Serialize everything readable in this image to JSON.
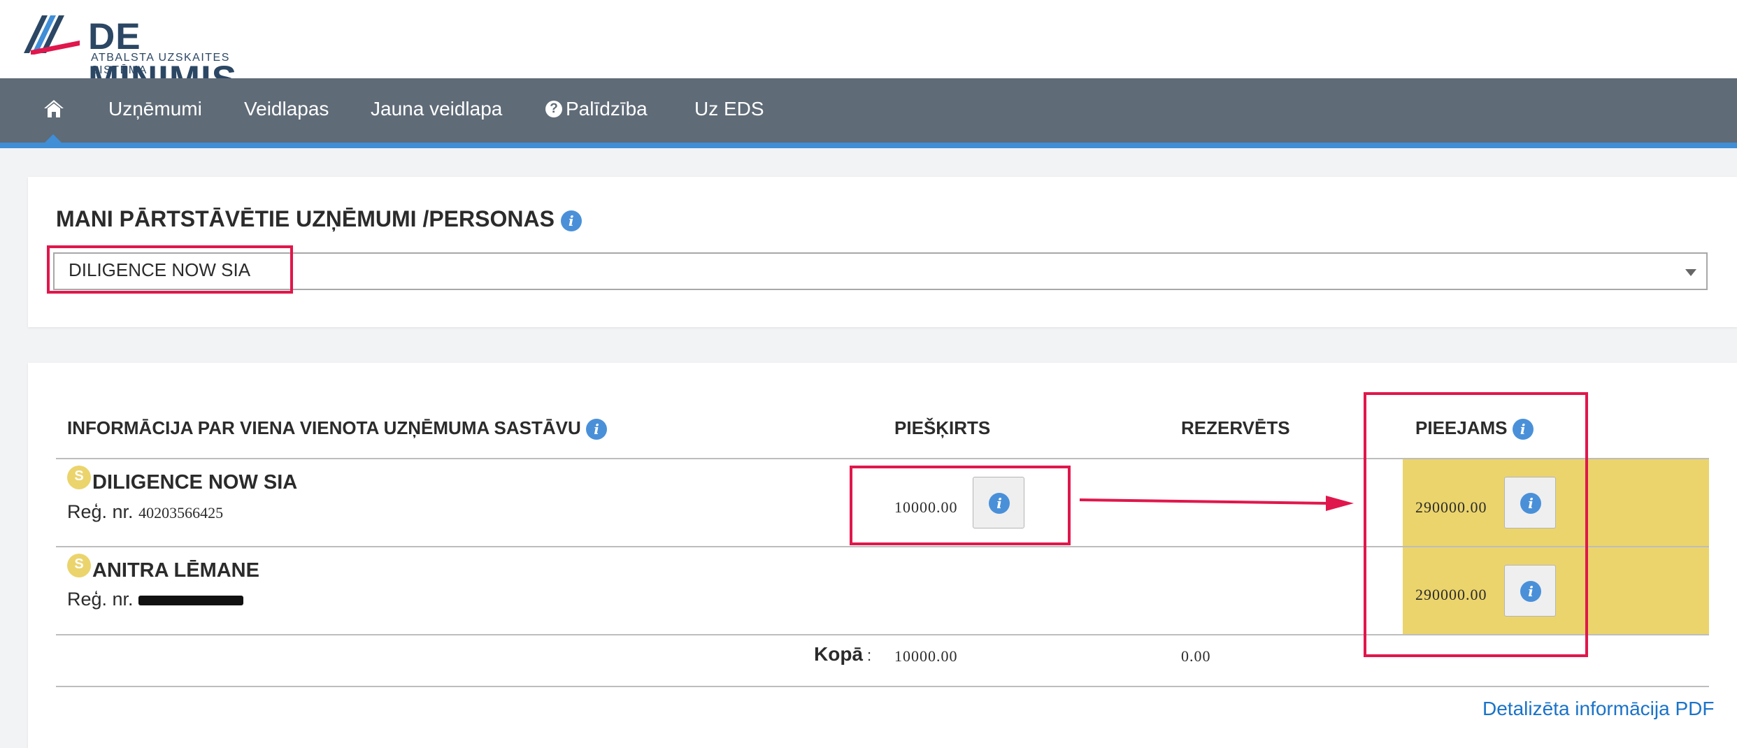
{
  "logo": {
    "name": "DE MINIMIS",
    "tagline": "ATBALSTA UZSKAITES SISTĒMA"
  },
  "nav": {
    "home_icon": "home-icon",
    "items": [
      {
        "label": "Uzņēmumi"
      },
      {
        "label": "Veidlapas"
      },
      {
        "label": "Jauna veidlapa"
      },
      {
        "label": "Palīdzība",
        "icon": "question-circle-icon"
      },
      {
        "label": "Uz EDS"
      }
    ]
  },
  "represented": {
    "title": "MANI PĀRTSTĀVĒTIE UZŅĒMUMI /PERSONAS",
    "selected": "DILIGENCE NOW SIA"
  },
  "table": {
    "headers": {
      "composition": "INFORMĀCIJA PAR VIENA VIENOTA UZŅĒMUMA SASTĀVU",
      "granted": "PIEŠĶIRTS",
      "reserved": "REZERVĒTS",
      "available": "PIEEJAMS"
    },
    "rows": [
      {
        "badge": "S",
        "name": "DILIGENCE NOW SIA",
        "reg_label": "Reģ. nr.",
        "reg_no": "40203566425",
        "granted": "10000.00",
        "available": "290000.00"
      },
      {
        "badge": "S",
        "name": "ANITRA LĒMANE",
        "reg_label": "Reģ. nr.",
        "reg_no": "",
        "granted": "",
        "available": "290000.00"
      }
    ],
    "total": {
      "label": "Kopā",
      "colon": ":",
      "granted": "10000.00",
      "reserved": "0.00"
    },
    "pdf_link": "Detalizēta informācija PDF"
  },
  "colors": {
    "nav_bg": "#5f6b77",
    "accent_blue": "#3f8ed6",
    "highlight_yellow": "#ebd46c",
    "annotation_red": "#e0174c",
    "link_blue": "#1a73c8"
  }
}
